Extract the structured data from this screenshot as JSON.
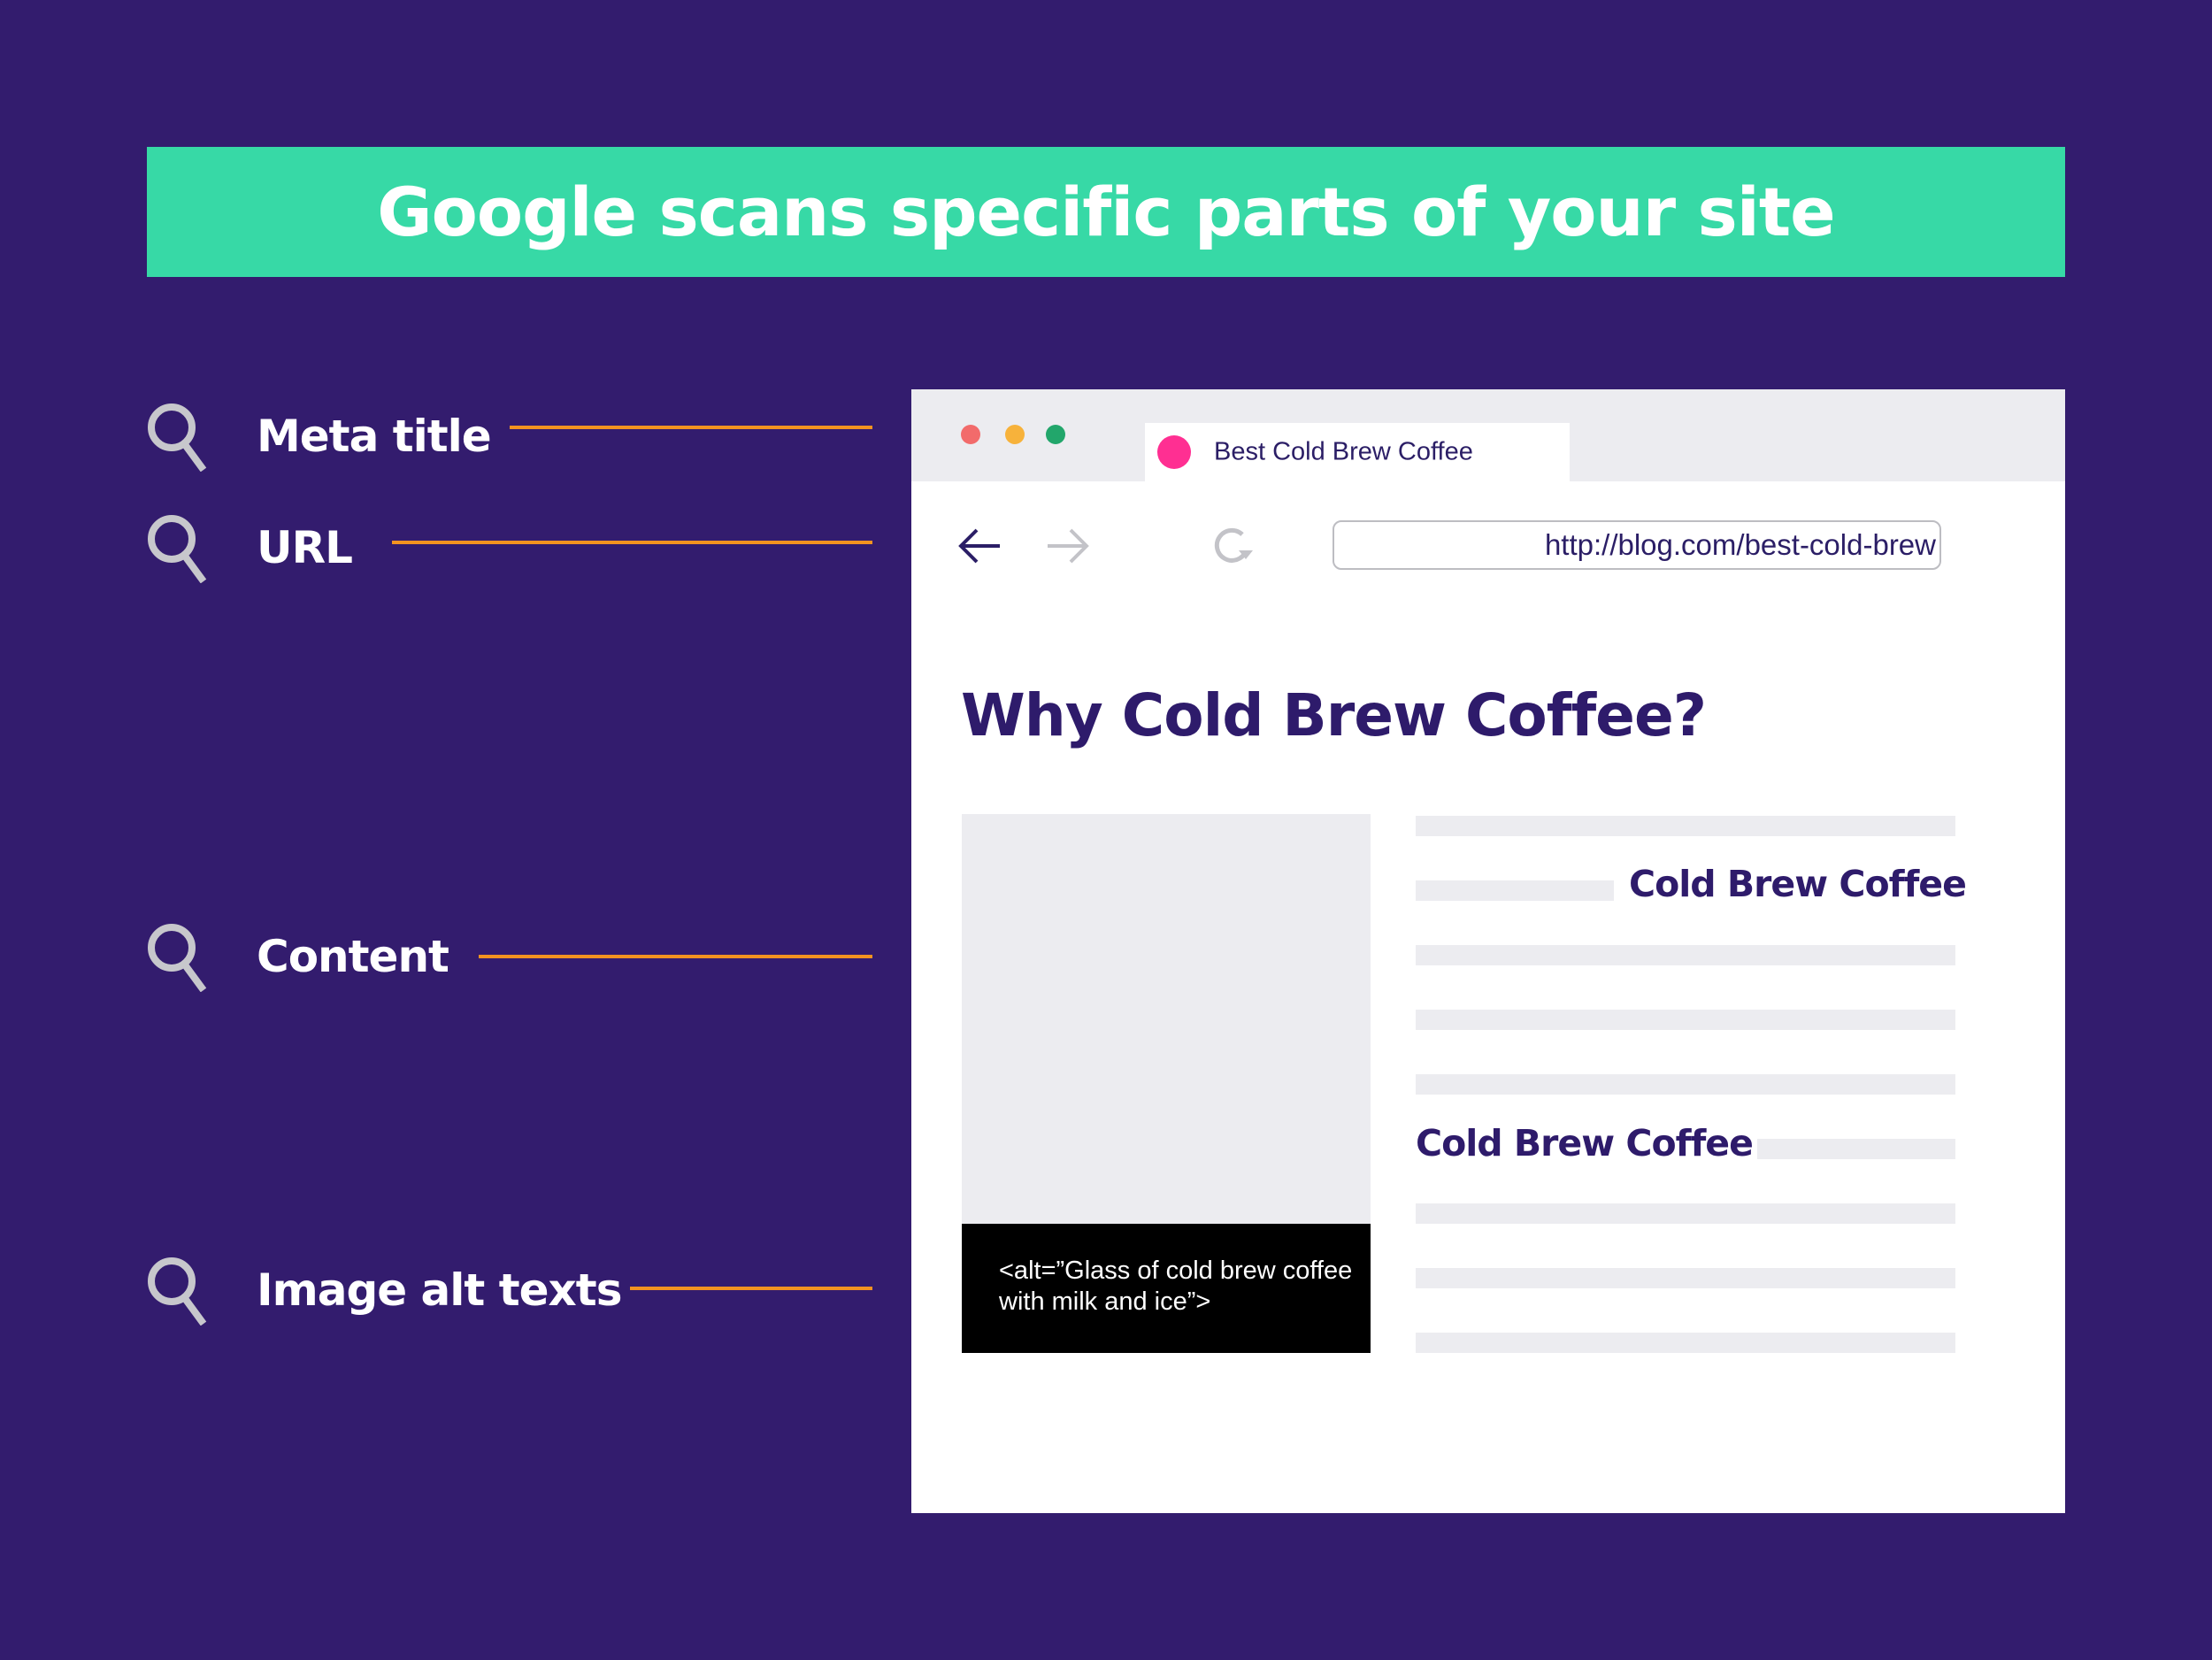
{
  "banner": {
    "title": "Google scans specific parts of your site",
    "color": "#37d9a6"
  },
  "theme": {
    "background": "#331c6e",
    "connector_color": "#f39320",
    "icon_color": "#c7c7cc",
    "text_dark": "#2e1b6b"
  },
  "labels": [
    {
      "text": "Meta title",
      "icon": "search-icon"
    },
    {
      "text": "URL",
      "icon": "search-icon"
    },
    {
      "text": "Content",
      "icon": "search-icon"
    },
    {
      "text": "Image alt texts",
      "icon": "search-icon"
    }
  ],
  "browser": {
    "window_controls": [
      {
        "name": "close",
        "color": "#f26b6b"
      },
      {
        "name": "minimize",
        "color": "#f7b23b"
      },
      {
        "name": "maximize",
        "color": "#22a66b"
      }
    ],
    "tab": {
      "title": "Best Cold Brew Coffee",
      "favicon_color": "#ff2f92"
    },
    "nav": {
      "back_icon": "arrow-left-icon",
      "forward_icon": "arrow-right-icon",
      "reload_icon": "reload-icon"
    },
    "url": "http://blog.com/best-cold-brew",
    "page": {
      "heading": "Why Cold Brew Coffee?",
      "subheadings": [
        "Cold Brew Coffee",
        "Cold Brew Coffee"
      ],
      "image_alt": "<alt=”Glass of cold brew coffee with milk and ice”>"
    }
  }
}
